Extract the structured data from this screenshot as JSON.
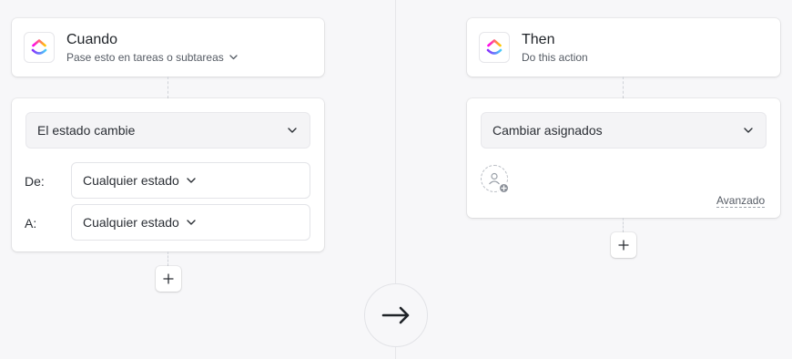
{
  "trigger": {
    "title": "Cuando",
    "subtitle": "Pase esto en tareas o subtareas",
    "condition_select": "El estado cambie",
    "from_label": "De:",
    "from_value": "Cualquier estado",
    "to_label": "A:",
    "to_value": "Cualquier estado"
  },
  "action": {
    "title": "Then",
    "subtitle": "Do this action",
    "action_select": "Cambiar asignados",
    "advanced_link": "Avanzado"
  },
  "icons": {
    "logo": "clickup-logo-icon",
    "chevron": "chevron-down-icon",
    "plus": "plus-icon",
    "arrow": "arrow-right-icon",
    "assignee": "add-assignee-icon"
  },
  "colors": {
    "background": "#f7f7f9",
    "card": "#ffffff",
    "text": "#2a2e34",
    "brand_purple": "#8930fd",
    "brand_pink": "#fe5b9d",
    "brand_orange": "#ffa12f",
    "brand_blue": "#49ccf9"
  }
}
